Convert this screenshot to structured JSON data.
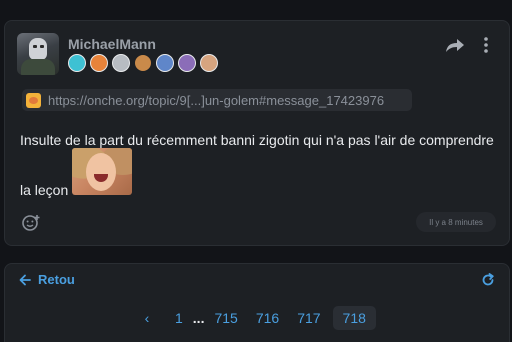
{
  "post": {
    "username": "MichaelMann",
    "badges": [
      {
        "icon": "badge-cyan-icon",
        "color": "#3ec1d3"
      },
      {
        "icon": "badge-orange-icon",
        "color": "#e8833a"
      },
      {
        "icon": "badge-grey-icon",
        "color": "#b7bcc2"
      },
      {
        "icon": "badge-character-icon",
        "color": "#c98a4a"
      },
      {
        "icon": "badge-blue-icon",
        "color": "#5f86c9"
      },
      {
        "icon": "badge-purple-icon",
        "color": "#8b6db8"
      },
      {
        "icon": "badge-face-icon",
        "color": "#d6a47f"
      }
    ],
    "link": "https://onche.org/topic/9[...]un-golem#message_17423976",
    "message_line1": "Insulte de la part du récemment banni zigotin qui n'a pas l'air de comprendre",
    "message_line2": "la leçon",
    "time": "Il y a 8 minutes"
  },
  "navigation": {
    "back_label": "Retou",
    "prev_symbol": "‹",
    "pages": [
      "1",
      "...",
      "715",
      "716",
      "717",
      "718"
    ],
    "current_page": "718"
  },
  "colors": {
    "background": "#121418",
    "card": "#1d2024",
    "accent": "#4a9fe0",
    "muted_text": "#9aa0a8"
  }
}
